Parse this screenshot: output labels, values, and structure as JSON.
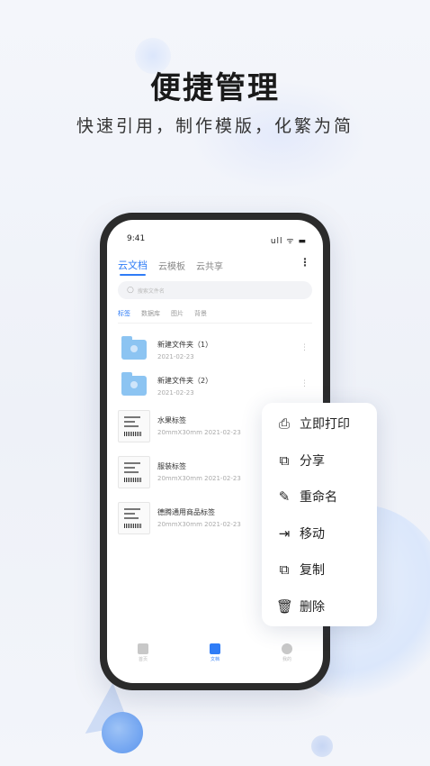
{
  "promo": {
    "headline": "便捷管理",
    "subline": "快速引用，制作模版，化繁为简"
  },
  "phone": {
    "status_time": "9:41",
    "status_icons": "ull ᯤ ▬",
    "tabs": [
      "云文档",
      "云模板",
      "云共享"
    ],
    "more_icon": "⋮",
    "search_placeholder": "搜索文件名",
    "categories": [
      "标签",
      "数据库",
      "图片",
      "背景"
    ],
    "items": [
      {
        "type": "folder",
        "name": "新建文件夹（1）",
        "meta": "2021-02-23"
      },
      {
        "type": "folder",
        "name": "新建文件夹（2）",
        "meta": "2021-02-23"
      },
      {
        "type": "label",
        "name": "水果标签",
        "meta": "20mmX30mm   2021-02-23"
      },
      {
        "type": "label",
        "name": "服装标签",
        "meta": "20mmX30mm   2021-02-23"
      },
      {
        "type": "label",
        "name": "德腾通用商品标签",
        "meta": "20mmX30mm   2021-02-23"
      }
    ],
    "bottom_nav": [
      "首页",
      "文档",
      "我的"
    ]
  },
  "context_menu": {
    "items": [
      {
        "icon": "printer-icon",
        "glyph": "⎙",
        "label": "立即打印"
      },
      {
        "icon": "share-icon",
        "glyph": "⧉",
        "label": "分享"
      },
      {
        "icon": "rename-icon",
        "glyph": "✎",
        "label": "重命名"
      },
      {
        "icon": "move-icon",
        "glyph": "⇥",
        "label": "移动"
      },
      {
        "icon": "copy-icon",
        "glyph": "⧉",
        "label": "复制"
      },
      {
        "icon": "delete-icon",
        "glyph": "🗑",
        "label": "删除"
      }
    ]
  },
  "colors": {
    "accent": "#2f7cf6",
    "folder": "#8cc4f2"
  }
}
